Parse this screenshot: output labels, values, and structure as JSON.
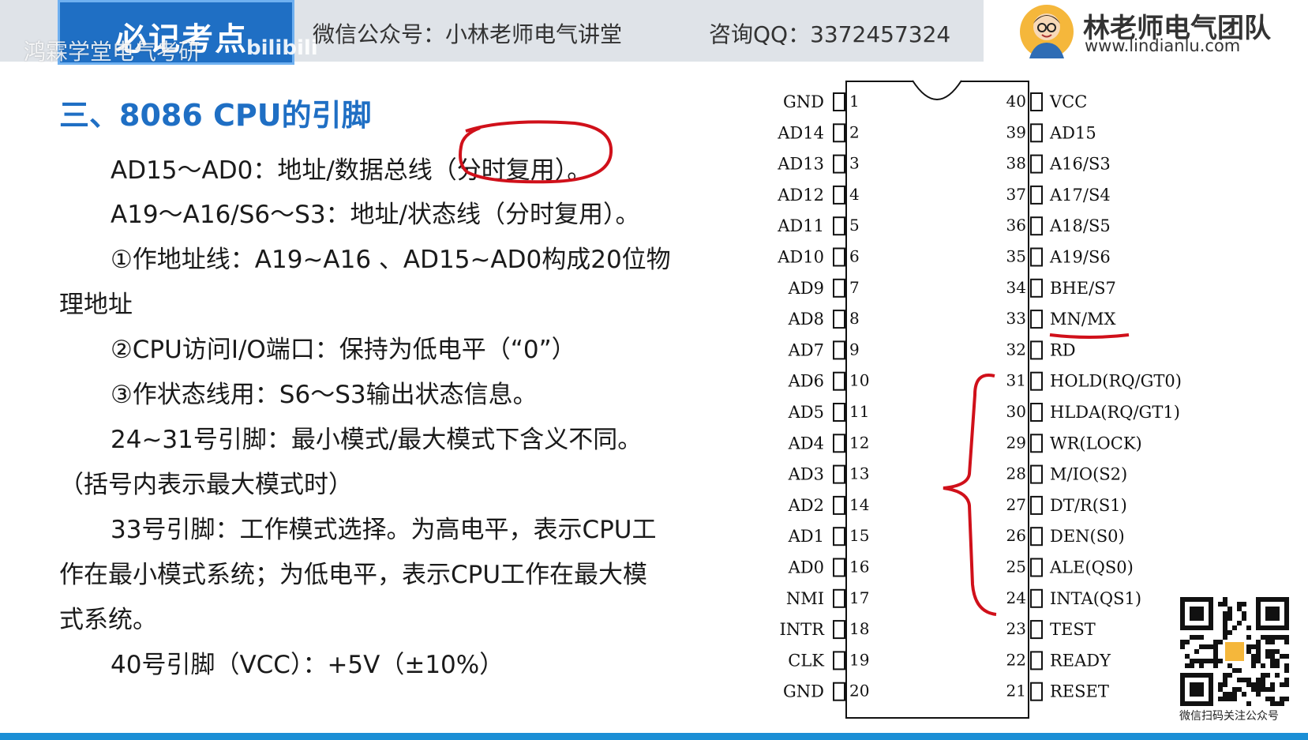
{
  "header": {
    "badge": "必记考点",
    "watermark": "鸿霖学堂电气考研",
    "bili": "bilibili",
    "wechat": "微信公众号：小林老师电气讲堂",
    "qq": "咨询QQ：3372457324",
    "brand_title": "林老师电气团队",
    "brand_url": "www.lindianlu.com"
  },
  "content": {
    "title": "三、8086 CPU的引脚",
    "lines": [
      "AD15～AD0：地址/数据总线（分时复用）。",
      "A19～A16/S6～S3：地址/状态线（分时复用）。",
      "①作地址线：A19~A16 、AD15~AD0构成20位物",
      "理地址",
      "②CPU访问I/O端口：保持为低电平（“0”）",
      "③作状态线用：S6～S3输出状态信息。",
      "24~31号引脚：最小模式/最大模式下含义不同。",
      "（括号内表示最大模式时）",
      "33号引脚：工作模式选择。为高电平，表示CPU工",
      "作在最小模式系统；为低电平，表示CPU工作在最大模",
      "式系统。",
      "40号引脚（VCC）：+5V（±10%）"
    ]
  },
  "pinout": {
    "left": [
      {
        "num": "1",
        "label": "GND"
      },
      {
        "num": "2",
        "label": "AD14"
      },
      {
        "num": "3",
        "label": "AD13"
      },
      {
        "num": "4",
        "label": "AD12"
      },
      {
        "num": "5",
        "label": "AD11"
      },
      {
        "num": "6",
        "label": "AD10"
      },
      {
        "num": "7",
        "label": "AD9"
      },
      {
        "num": "8",
        "label": "AD8"
      },
      {
        "num": "9",
        "label": "AD7"
      },
      {
        "num": "10",
        "label": "AD6"
      },
      {
        "num": "11",
        "label": "AD5"
      },
      {
        "num": "12",
        "label": "AD4"
      },
      {
        "num": "13",
        "label": "AD3"
      },
      {
        "num": "14",
        "label": "AD2"
      },
      {
        "num": "15",
        "label": "AD1"
      },
      {
        "num": "16",
        "label": "AD0"
      },
      {
        "num": "17",
        "label": "NMI"
      },
      {
        "num": "18",
        "label": "INTR"
      },
      {
        "num": "19",
        "label": "CLK"
      },
      {
        "num": "20",
        "label": "GND"
      }
    ],
    "right": [
      {
        "num": "40",
        "label": "VCC"
      },
      {
        "num": "39",
        "label": "AD15"
      },
      {
        "num": "38",
        "label": "A16/S3"
      },
      {
        "num": "37",
        "label": "A17/S4"
      },
      {
        "num": "36",
        "label": "A18/S5"
      },
      {
        "num": "35",
        "label": "A19/S6"
      },
      {
        "num": "34",
        "label": "BHE/S7"
      },
      {
        "num": "33",
        "label": "MN/MX"
      },
      {
        "num": "32",
        "label": "RD"
      },
      {
        "num": "31",
        "label": "HOLD(RQ/GT0)"
      },
      {
        "num": "30",
        "label": "HLDA(RQ/GT1)"
      },
      {
        "num": "29",
        "label": "WR(LOCK)"
      },
      {
        "num": "28",
        "label": "M/IO(S2)"
      },
      {
        "num": "27",
        "label": "DT/R(S1)"
      },
      {
        "num": "26",
        "label": "DEN(S0)"
      },
      {
        "num": "25",
        "label": "ALE(QS0)"
      },
      {
        "num": "24",
        "label": "INTA(QS1)"
      },
      {
        "num": "23",
        "label": "TEST"
      },
      {
        "num": "22",
        "label": "READY"
      },
      {
        "num": "21",
        "label": "RESET"
      }
    ]
  },
  "qr_caption": "微信扫码关注公众号",
  "colors": {
    "accent": "#1f6fc4",
    "annotation": "#d0101a",
    "bottom_bar": "#1b8fd6"
  }
}
